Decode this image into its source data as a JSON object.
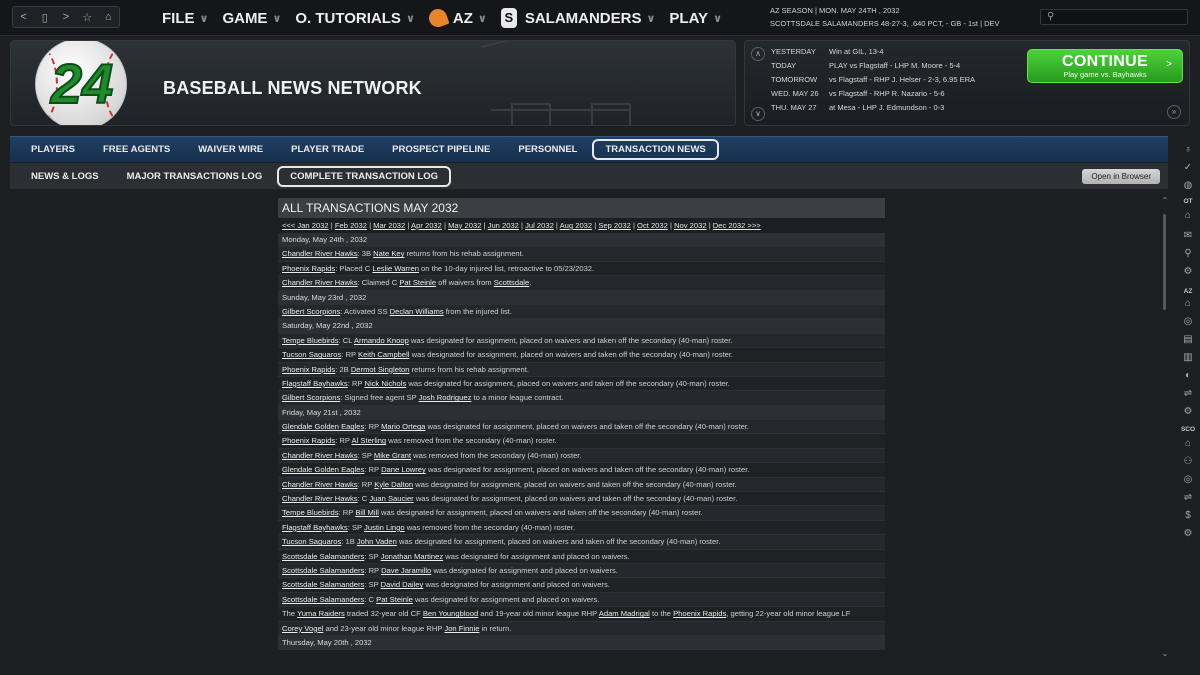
{
  "nav": {
    "back": "<",
    "page": "▯",
    "forward": ">",
    "star": "☆",
    "home": "⌂"
  },
  "menu": [
    {
      "label": "FILE"
    },
    {
      "label": "GAME"
    },
    {
      "label": "O. TUTORIALS"
    },
    {
      "label": "AZ"
    },
    {
      "label": "SALAMANDERS"
    },
    {
      "label": "PLAY"
    }
  ],
  "season": {
    "line1": "AZ SEASON  |  MON. MAY 24TH , 2032",
    "line2": "SCOTTSDALE SALAMANDERS  48-27-3, .640 PCT, - GB - 1st | DEV"
  },
  "banner": {
    "logo_number": "24",
    "title": "BASEBALL NEWS NETWORK"
  },
  "schedule": [
    {
      "day": "YESTERDAY",
      "text": "Win at GIL, 13-4"
    },
    {
      "day": "TODAY",
      "text": "PLAY vs Flagstaff - LHP M. Moore - 5-4"
    },
    {
      "day": "TOMORROW",
      "text": "vs Flagstaff - RHP J. Helser - 2-3, 6.95 ERA"
    },
    {
      "day": "WED. MAY 26",
      "text": "vs Flagstaff - RHP R. Nazario - 5-6"
    },
    {
      "day": "THU. MAY 27",
      "text": "at Mesa - LHP J. Edmundson - 0-3"
    }
  ],
  "continue": {
    "label": "CONTINUE",
    "sub": "Play game vs. Bayhawks"
  },
  "tabs1": [
    "PLAYERS",
    "FREE AGENTS",
    "WAIVER WIRE",
    "PLAYER TRADE",
    "PROSPECT PIPELINE",
    "PERSONNEL",
    "TRANSACTION NEWS"
  ],
  "tabs2": [
    "NEWS & LOGS",
    "MAJOR TRANSACTIONS LOG",
    "COMPLETE TRANSACTION LOG"
  ],
  "open_browser": "Open in Browser",
  "log": {
    "title": "ALL TRANSACTIONS MAY 2032",
    "months": [
      "<<< Jan 2032",
      "Feb 2032",
      "Mar 2032",
      "Apr 2032",
      "May 2032",
      "Jun 2032",
      "Jul 2032",
      "Aug 2032",
      "Sep 2032",
      "Oct 2032",
      "Nov 2032",
      "Dec 2032 >>>"
    ],
    "entries": [
      {
        "type": "date",
        "text": "Monday, May 24th , 2032"
      },
      {
        "type": "txn",
        "parts": [
          [
            "a",
            "Chandler River Hawks"
          ],
          [
            "t",
            ": 3B "
          ],
          [
            "a",
            "Nate Key"
          ],
          [
            "t",
            " returns from his rehab assignment."
          ]
        ]
      },
      {
        "type": "txn",
        "parts": [
          [
            "a",
            "Phoenix Rapids"
          ],
          [
            "t",
            ": Placed C "
          ],
          [
            "a",
            "Leslie Warren"
          ],
          [
            "t",
            " on the 10-day injured list, retroactive to 05/23/2032."
          ]
        ]
      },
      {
        "type": "txn",
        "parts": [
          [
            "a",
            "Chandler River Hawks"
          ],
          [
            "t",
            ": Claimed C "
          ],
          [
            "a",
            "Pat Steinle"
          ],
          [
            "t",
            " off waivers from "
          ],
          [
            "a",
            "Scottsdale"
          ],
          [
            "t",
            "."
          ]
        ]
      },
      {
        "type": "date",
        "text": "Sunday, May 23rd , 2032"
      },
      {
        "type": "txn",
        "parts": [
          [
            "a",
            "Gilbert Scorpions"
          ],
          [
            "t",
            ": Activated SS "
          ],
          [
            "a",
            "Declan Williams"
          ],
          [
            "t",
            " from the injured list."
          ]
        ]
      },
      {
        "type": "date",
        "text": "Saturday, May 22nd , 2032"
      },
      {
        "type": "txn",
        "parts": [
          [
            "a",
            "Tempe Bluebirds"
          ],
          [
            "t",
            ": CL "
          ],
          [
            "a",
            "Armando Knoop"
          ],
          [
            "t",
            " was designated for assignment, placed on waivers and taken off the secondary (40-man) roster."
          ]
        ]
      },
      {
        "type": "txn",
        "parts": [
          [
            "a",
            "Tucson Saguaros"
          ],
          [
            "t",
            ": RP "
          ],
          [
            "a",
            "Keith Campbell"
          ],
          [
            "t",
            " was designated for assignment, placed on waivers and taken off the secondary (40-man) roster."
          ]
        ]
      },
      {
        "type": "txn",
        "parts": [
          [
            "a",
            "Phoenix Rapids"
          ],
          [
            "t",
            ": 2B "
          ],
          [
            "a",
            "Dermot Singleton"
          ],
          [
            "t",
            " returns from his rehab assignment."
          ]
        ]
      },
      {
        "type": "txn",
        "parts": [
          [
            "a",
            "Flagstaff Bayhawks"
          ],
          [
            "t",
            ": RP "
          ],
          [
            "a",
            "Nick Nichols"
          ],
          [
            "t",
            " was designated for assignment, placed on waivers and taken off the secondary (40-man) roster."
          ]
        ]
      },
      {
        "type": "txn",
        "parts": [
          [
            "a",
            "Gilbert Scorpions"
          ],
          [
            "t",
            ": Signed free agent SP "
          ],
          [
            "a",
            "Josh Rodriguez"
          ],
          [
            "t",
            " to a minor league contract."
          ]
        ]
      },
      {
        "type": "date",
        "text": "Friday, May 21st , 2032"
      },
      {
        "type": "txn",
        "parts": [
          [
            "a",
            "Glendale Golden Eagles"
          ],
          [
            "t",
            ": RP "
          ],
          [
            "a",
            "Mario Ortega"
          ],
          [
            "t",
            " was designated for assignment, placed on waivers and taken off the secondary (40-man) roster."
          ]
        ]
      },
      {
        "type": "txn",
        "parts": [
          [
            "a",
            "Phoenix Rapids"
          ],
          [
            "t",
            ": RP "
          ],
          [
            "a",
            "Al Sterling"
          ],
          [
            "t",
            " was removed from the secondary (40-man) roster."
          ]
        ]
      },
      {
        "type": "txn",
        "parts": [
          [
            "a",
            "Chandler River Hawks"
          ],
          [
            "t",
            ": SP "
          ],
          [
            "a",
            "Mike Grant"
          ],
          [
            "t",
            " was removed from the secondary (40-man) roster."
          ]
        ]
      },
      {
        "type": "txn",
        "parts": [
          [
            "a",
            "Glendale Golden Eagles"
          ],
          [
            "t",
            ": RP "
          ],
          [
            "a",
            "Dane Lowrey"
          ],
          [
            "t",
            " was designated for assignment, placed on waivers and taken off the secondary (40-man) roster."
          ]
        ]
      },
      {
        "type": "txn",
        "parts": [
          [
            "a",
            "Chandler River Hawks"
          ],
          [
            "t",
            ": RP "
          ],
          [
            "a",
            "Kyle Dalton"
          ],
          [
            "t",
            " was designated for assignment, placed on waivers and taken off the secondary (40-man) roster."
          ]
        ]
      },
      {
        "type": "txn",
        "parts": [
          [
            "a",
            "Chandler River Hawks"
          ],
          [
            "t",
            ": C "
          ],
          [
            "a",
            "Juan Saucier"
          ],
          [
            "t",
            " was designated for assignment, placed on waivers and taken off the secondary (40-man) roster."
          ]
        ]
      },
      {
        "type": "txn",
        "parts": [
          [
            "a",
            "Tempe Bluebirds"
          ],
          [
            "t",
            ": RP "
          ],
          [
            "a",
            "Bill Mill"
          ],
          [
            "t",
            " was designated for assignment, placed on waivers and taken off the secondary (40-man) roster."
          ]
        ]
      },
      {
        "type": "txn",
        "parts": [
          [
            "a",
            "Flagstaff Bayhawks"
          ],
          [
            "t",
            ": SP "
          ],
          [
            "a",
            "Justin Lingo"
          ],
          [
            "t",
            " was removed from the secondary (40-man) roster."
          ]
        ]
      },
      {
        "type": "txn",
        "parts": [
          [
            "a",
            "Tucson Saguaros"
          ],
          [
            "t",
            ": 1B "
          ],
          [
            "a",
            "John Vaden"
          ],
          [
            "t",
            " was designated for assignment, placed on waivers and taken off the secondary (40-man) roster."
          ]
        ]
      },
      {
        "type": "txn",
        "parts": [
          [
            "a",
            "Scottsdale Salamanders"
          ],
          [
            "t",
            ": SP "
          ],
          [
            "a",
            "Jonathan Martinez"
          ],
          [
            "t",
            " was designated for assignment and placed on waivers."
          ]
        ]
      },
      {
        "type": "txn",
        "parts": [
          [
            "a",
            "Scottsdale Salamanders"
          ],
          [
            "t",
            ": RP "
          ],
          [
            "a",
            "Dave Jaramillo"
          ],
          [
            "t",
            " was designated for assignment and placed on waivers."
          ]
        ]
      },
      {
        "type": "txn",
        "parts": [
          [
            "a",
            "Scottsdale Salamanders"
          ],
          [
            "t",
            ": SP "
          ],
          [
            "a",
            "David Dailey"
          ],
          [
            "t",
            " was designated for assignment and placed on waivers."
          ]
        ]
      },
      {
        "type": "txn",
        "parts": [
          [
            "a",
            "Scottsdale Salamanders"
          ],
          [
            "t",
            ": C "
          ],
          [
            "a",
            "Pat Steinle"
          ],
          [
            "t",
            " was designated for assignment and placed on waivers."
          ]
        ]
      },
      {
        "type": "txn",
        "parts": [
          [
            "t",
            "The "
          ],
          [
            "a",
            "Yuma Raiders"
          ],
          [
            "t",
            " traded 32-year old CF "
          ],
          [
            "a",
            "Ben Youngblood"
          ],
          [
            "t",
            " and 19-year old minor league RHP "
          ],
          [
            "a",
            "Adam Madrigal"
          ],
          [
            "t",
            " to the "
          ],
          [
            "a",
            "Phoenix Rapids"
          ],
          [
            "t",
            ", getting 22-year old minor league LF"
          ]
        ]
      },
      {
        "type": "txn",
        "parts": [
          [
            "a",
            "Corey Vogel"
          ],
          [
            "t",
            " and 23-year old minor league RHP "
          ],
          [
            "a",
            "Jon Finnie"
          ],
          [
            "t",
            " in return."
          ]
        ]
      },
      {
        "type": "date",
        "text": "Thursday, May 20th , 2032"
      }
    ]
  },
  "rail": {
    "labels": {
      "ot": "OT",
      "az": "AZ",
      "sco": "SCO"
    },
    "icons": [
      "lightbulb-icon",
      "check-icon",
      "globe-icon",
      "home-icon",
      "mail-icon",
      "search-icon",
      "gear-icon",
      "home-icon",
      "target-icon",
      "id-card-icon",
      "bar-chart-icon",
      "baseball-icon",
      "transactions-icon",
      "gear-icon",
      "home-icon",
      "roster-icon",
      "target-icon",
      "transactions-icon",
      "dollar-icon",
      "gear-icon"
    ]
  },
  "colors": {
    "accent_blue": "#1f3e63",
    "continue_green": "#3cbf2e"
  }
}
